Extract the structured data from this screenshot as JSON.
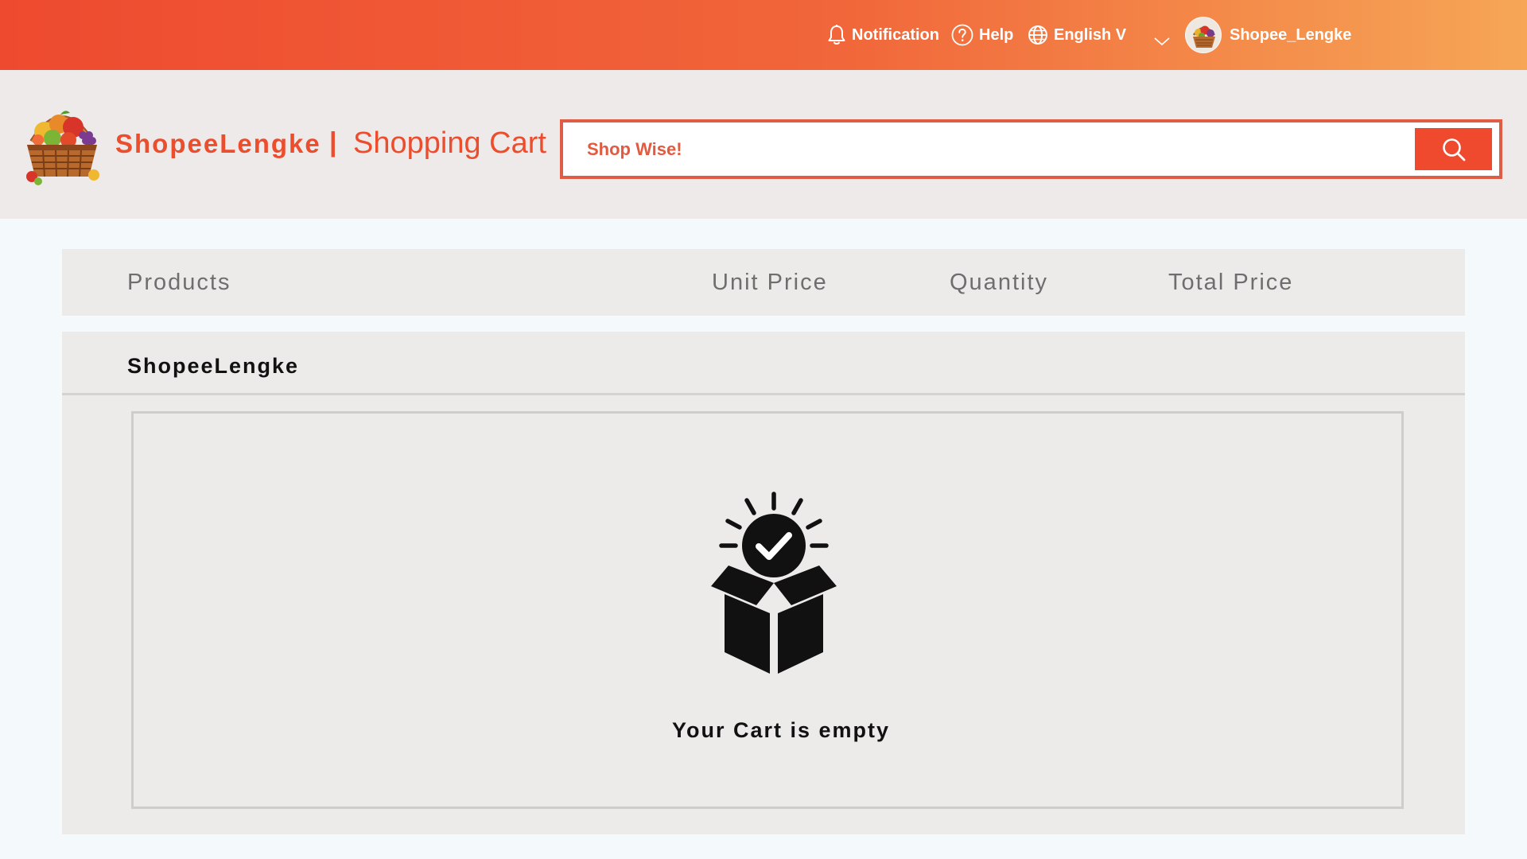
{
  "topbar": {
    "notification_label": "Notification",
    "help_label": "Help",
    "language_label": "English V",
    "username": "Shopee_Lengke"
  },
  "header": {
    "brand": "ShopeeLengke",
    "separator": "|",
    "page_name": "Shopping Cart",
    "search_placeholder": "Shop Wise!"
  },
  "cart_table": {
    "columns": [
      "Products",
      "Unit Price",
      "Quantity",
      "Total Price"
    ]
  },
  "shop": {
    "name": "ShopeeLengke",
    "empty_message": "Your Cart is empty"
  },
  "colors": {
    "brand_orange": "#ec4d2d",
    "topbar_start": "#ee4a2f",
    "topbar_end": "#f6a656",
    "panel_bg": "#edeaea"
  },
  "icons": {
    "notification": "bell-icon",
    "help": "question-circle-icon",
    "language": "globe-icon",
    "dropdown": "chevron-down-icon",
    "search": "search-icon",
    "empty_cart": "open-box-check-icon"
  }
}
